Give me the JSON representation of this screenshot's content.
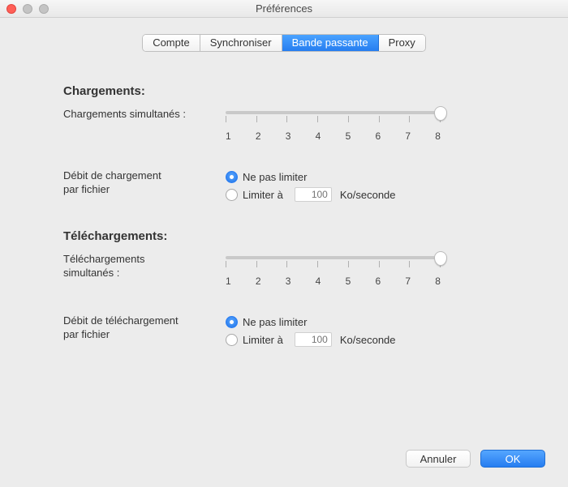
{
  "window": {
    "title": "Préférences"
  },
  "tabs": {
    "items": [
      "Compte",
      "Synchroniser",
      "Bande passante",
      "Proxy"
    ],
    "active_index": 2
  },
  "uploads": {
    "section_title": "Chargements:",
    "simultaneous_label": "Chargements simultanés :",
    "slider": {
      "min": 1,
      "max": 8,
      "value": 8,
      "ticks": [
        "1",
        "2",
        "3",
        "4",
        "5",
        "6",
        "7",
        "8"
      ]
    },
    "rate_label_l1": "Débit de chargement",
    "rate_label_l2": "par fichier",
    "rate": {
      "selected": "no_limit",
      "no_limit_label": "Ne pas limiter",
      "limit_label": "Limiter à",
      "limit_value": "100",
      "unit": "Ko/seconde"
    }
  },
  "downloads": {
    "section_title": "Téléchargements:",
    "simultaneous_label_l1": "Téléchargements",
    "simultaneous_label_l2": "simultanés :",
    "slider": {
      "min": 1,
      "max": 8,
      "value": 8,
      "ticks": [
        "1",
        "2",
        "3",
        "4",
        "5",
        "6",
        "7",
        "8"
      ]
    },
    "rate_label_l1": "Débit de téléchargement",
    "rate_label_l2": "par fichier",
    "rate": {
      "selected": "no_limit",
      "no_limit_label": "Ne pas limiter",
      "limit_label": "Limiter à",
      "limit_value": "100",
      "unit": "Ko/seconde"
    }
  },
  "footer": {
    "cancel": "Annuler",
    "ok": "OK"
  }
}
